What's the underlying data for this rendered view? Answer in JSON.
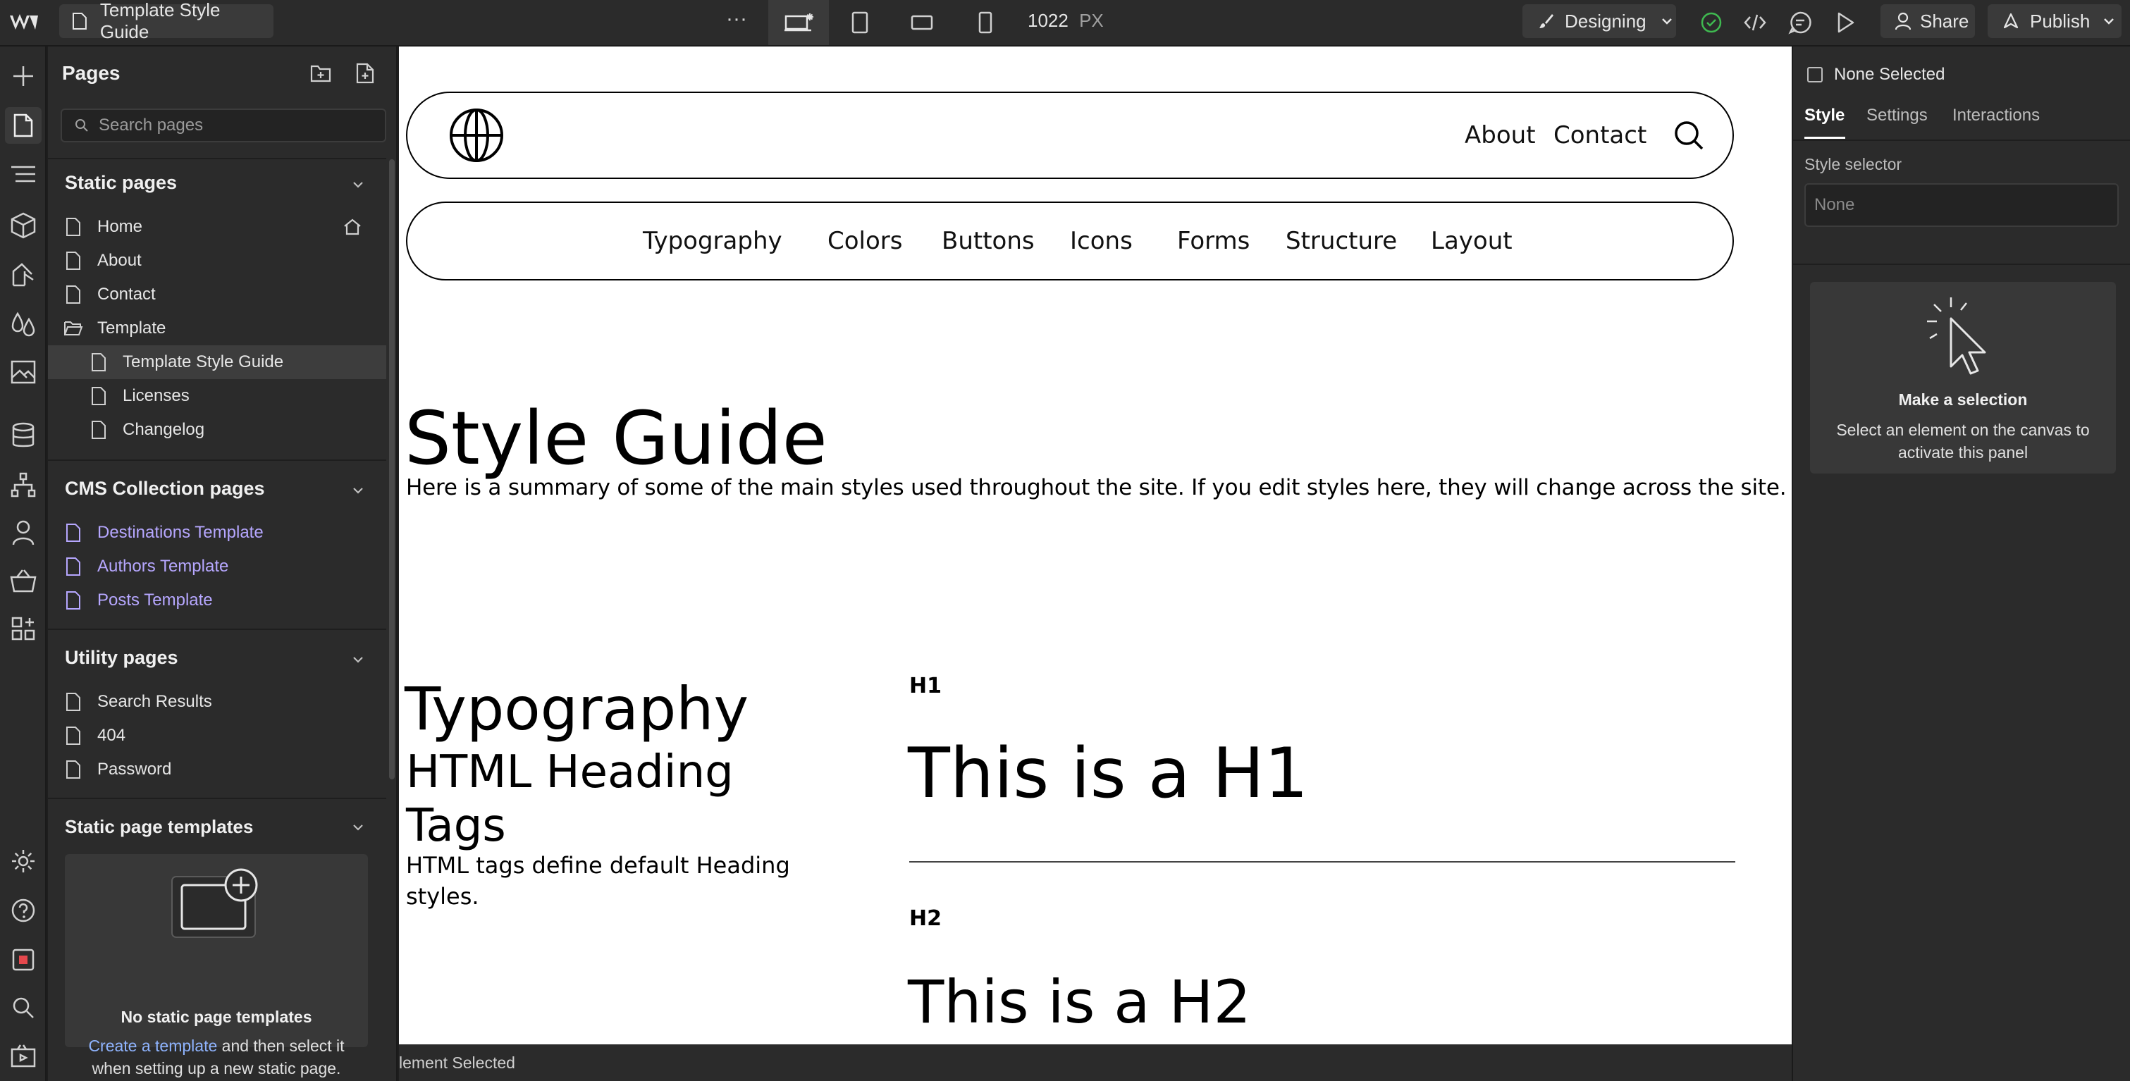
{
  "topbar": {
    "page_name": "Template Style Guide",
    "more": "···",
    "width_value": "1022",
    "width_unit": "PX",
    "mode_label": "Designing",
    "share_label": "Share",
    "publish_label": "Publish"
  },
  "pages_panel": {
    "title": "Pages",
    "search_placeholder": "Search pages",
    "static_title": "Static pages",
    "static_items": [
      {
        "label": "Home"
      },
      {
        "label": "About"
      },
      {
        "label": "Contact"
      },
      {
        "label": "Template"
      },
      {
        "label": "Template Style Guide"
      },
      {
        "label": "Licenses"
      },
      {
        "label": "Changelog"
      }
    ],
    "cms_title": "CMS Collection pages",
    "cms_items": [
      {
        "label": "Destinations Template"
      },
      {
        "label": "Authors Template"
      },
      {
        "label": "Posts Template"
      }
    ],
    "utility_title": "Utility pages",
    "utility_items": [
      {
        "label": "Search Results"
      },
      {
        "label": "404"
      },
      {
        "label": "Password"
      }
    ],
    "templates_title": "Static page templates",
    "templates_empty_title": "No static page templates",
    "templates_link": "Create a template",
    "templates_text_1": " and then select it",
    "templates_text_2": "when setting up a new static page."
  },
  "canvas": {
    "nav_about": "About",
    "nav_contact": "Contact",
    "subnav": [
      "Typography",
      "Colors",
      "Buttons",
      "Icons",
      "Forms",
      "Structure",
      "Layout"
    ],
    "hero_title": "Style Guide",
    "hero_text": "Here is a summary of some of the main styles used throughout the site. If you edit styles here, they will change across the site.",
    "typo_title": "Typography",
    "typo_subtitle_1": "HTML Heading",
    "typo_subtitle_2": "Tags",
    "typo_desc_1": "HTML tags define default Heading",
    "typo_desc_2": "styles.",
    "h1_label": "H1",
    "h1_sample": "This is a H1",
    "h2_label": "H2",
    "h2_sample": "This is a H2"
  },
  "status": {
    "text": "lement Selected"
  },
  "right_panel": {
    "none_selected": "None Selected",
    "tabs": [
      "Style",
      "Settings",
      "Interactions"
    ],
    "style_selector_label": "Style selector",
    "style_selector_placeholder": "None",
    "empty_title": "Make a selection",
    "empty_text_1": "Select an element on the canvas to",
    "empty_text_2": "activate this panel"
  },
  "colors": {
    "accent_green": "#3fb950",
    "cms_purple": "#b6a7ff",
    "link_blue": "#8fb4ff"
  }
}
